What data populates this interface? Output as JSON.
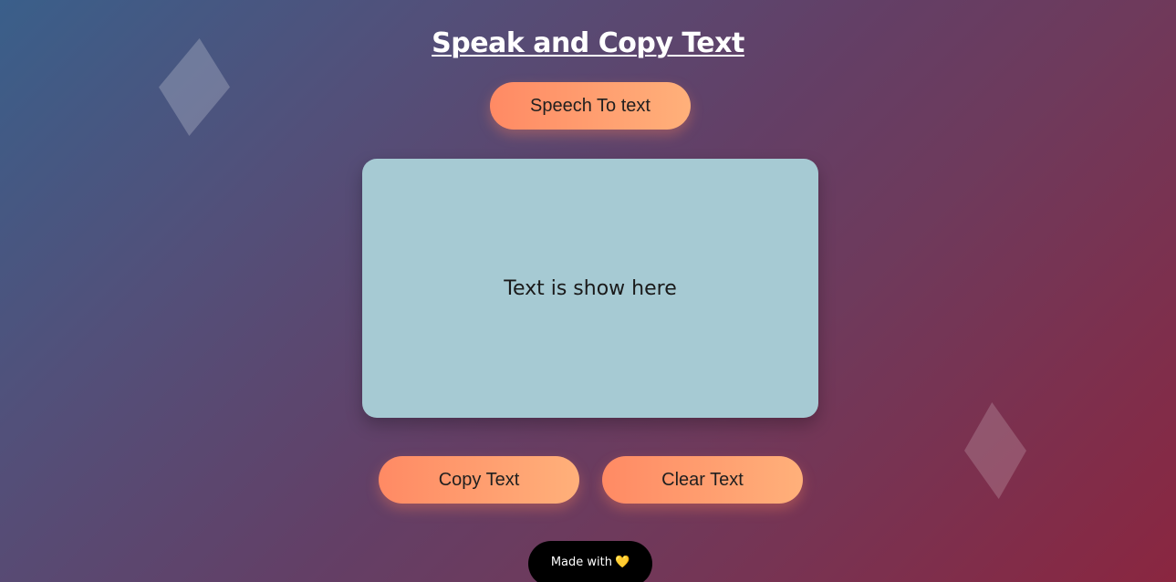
{
  "page": {
    "title": "Speak and Copy Text"
  },
  "buttons": {
    "speech_label": "Speech To text",
    "copy_label": "Copy Text",
    "clear_label": "Clear Text"
  },
  "output": {
    "text": "Text is show here"
  },
  "footer": {
    "label": "Made with",
    "heart_icon": "heart-icon",
    "heart_glyph": "💛"
  },
  "colors": {
    "button_gradient_start": "#ff8a64",
    "button_gradient_end": "#ffb07a",
    "textbox_bg": "#a6cad3",
    "footer_bg": "#000000",
    "heart": "#f5c518"
  }
}
